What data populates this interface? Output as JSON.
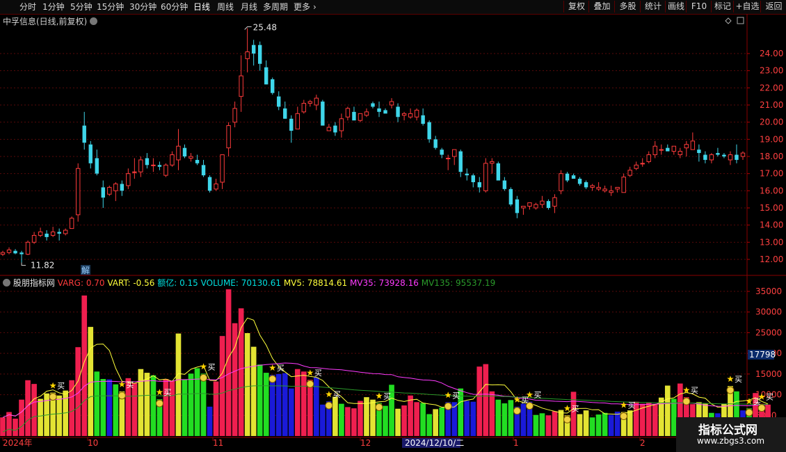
{
  "toolbar": {
    "periods": [
      "分时",
      "1分钟",
      "5分钟",
      "15分钟",
      "30分钟",
      "60分钟",
      "日线",
      "周线",
      "月线",
      "多周期",
      "更多"
    ],
    "active_period": "日线",
    "right_buttons": [
      "复权",
      "叠加",
      "多股",
      "统计",
      "画线",
      "F10",
      "标记",
      "+自选",
      "返回"
    ]
  },
  "price_panel": {
    "title": "中孚信息(日线,前复权)",
    "y_ticks": [
      "24.00",
      "23.00",
      "22.00",
      "21.00",
      "20.00",
      "19.00",
      "18.00",
      "17.00",
      "16.00",
      "15.00",
      "14.00",
      "13.00",
      "12.00"
    ],
    "max_label": "25.48",
    "min_label": "11.82",
    "marker_label": "解"
  },
  "indicator_panel": {
    "name": "股朋指标网",
    "legend": [
      {
        "text": "VARG: 0.70",
        "color": "#ff3b3b"
      },
      {
        "text": "VART: -0.56",
        "color": "#ffff3b"
      },
      {
        "text": "额亿: 0.15",
        "color": "#00e0e0"
      },
      {
        "text": "VOLUME: 70130.61",
        "color": "#00e0e0"
      },
      {
        "text": "MV5: 78814.61",
        "color": "#ffff3b"
      },
      {
        "text": "MV35: 73928.16",
        "color": "#ff3bff"
      },
      {
        "text": "MV135: 95537.19",
        "color": "#2a9a2a"
      }
    ],
    "y_ticks": [
      "35000",
      "30000",
      "25000",
      "20000",
      "15000",
      "10000",
      "5000"
    ],
    "current_value": "17798",
    "buy_label": "买"
  },
  "x_axis": {
    "labels": [
      "2024年",
      "10",
      "11",
      "12",
      "2024/12/10/二",
      "1",
      "2"
    ]
  },
  "watermark": {
    "line1": "指标公式网",
    "line2": "www.zbgs3.com"
  },
  "chart_data": [
    {
      "type": "candlestick",
      "title": "中孚信息(日线,前复权)",
      "ylim": [
        11.4,
        25.7
      ],
      "ohlc": [
        [
          12.3,
          12.5,
          12.2,
          12.4
        ],
        [
          12.4,
          12.7,
          12.3,
          12.55
        ],
        [
          12.5,
          12.6,
          12.3,
          12.35
        ],
        [
          12.4,
          12.5,
          11.82,
          12.3
        ],
        [
          12.3,
          13.1,
          12.25,
          13.0
        ],
        [
          13.0,
          13.6,
          12.9,
          13.4
        ],
        [
          13.4,
          13.85,
          13.3,
          13.6
        ],
        [
          13.5,
          13.7,
          13.1,
          13.3
        ],
        [
          13.4,
          13.9,
          13.3,
          13.6
        ],
        [
          13.6,
          13.8,
          13.1,
          13.5
        ],
        [
          13.5,
          13.8,
          13.4,
          13.7
        ],
        [
          13.8,
          14.5,
          13.8,
          14.4
        ],
        [
          14.6,
          17.6,
          14.2,
          17.3
        ],
        [
          19.8,
          20.6,
          18.4,
          18.8
        ],
        [
          18.7,
          18.9,
          17.3,
          17.6
        ],
        [
          17.9,
          18.4,
          16.9,
          17.0
        ],
        [
          16.2,
          16.6,
          15.0,
          15.6
        ],
        [
          15.8,
          16.3,
          15.7,
          16.2
        ],
        [
          16.0,
          16.5,
          15.4,
          16.4
        ],
        [
          16.4,
          16.6,
          15.7,
          16.0
        ],
        [
          16.3,
          17.3,
          16.1,
          17.0
        ],
        [
          17.1,
          17.9,
          16.7,
          17.1
        ],
        [
          17.1,
          18.0,
          16.8,
          17.8
        ],
        [
          17.9,
          18.2,
          17.3,
          17.5
        ],
        [
          17.5,
          17.9,
          17.1,
          17.5
        ],
        [
          17.5,
          17.7,
          17.2,
          17.4
        ],
        [
          16.9,
          17.6,
          16.8,
          17.5
        ],
        [
          17.5,
          18.3,
          17.4,
          18.1
        ],
        [
          17.8,
          19.6,
          17.2,
          18.6
        ],
        [
          18.5,
          18.7,
          17.9,
          18.0
        ],
        [
          17.9,
          18.2,
          17.7,
          18.0
        ],
        [
          17.8,
          18.1,
          17.5,
          17.6
        ],
        [
          17.5,
          17.8,
          16.8,
          16.9
        ],
        [
          16.8,
          16.9,
          15.9,
          16.0
        ],
        [
          16.1,
          16.7,
          16.0,
          16.4
        ],
        [
          16.5,
          18.1,
          16.1,
          18.1
        ],
        [
          18.5,
          20.0,
          18.0,
          19.8
        ],
        [
          20.0,
          21.2,
          19.7,
          20.8
        ],
        [
          21.5,
          23.9,
          20.6,
          22.7
        ],
        [
          23.7,
          25.48,
          22.9,
          24.1
        ],
        [
          24.5,
          24.8,
          23.3,
          24.0
        ],
        [
          24.5,
          24.7,
          23.0,
          23.4
        ],
        [
          23.2,
          23.6,
          22.3,
          22.2
        ],
        [
          22.5,
          22.6,
          21.6,
          21.7
        ],
        [
          21.5,
          21.8,
          20.7,
          20.9
        ],
        [
          20.8,
          21.2,
          20.3,
          20.2
        ],
        [
          20.2,
          20.4,
          18.8,
          19.5
        ],
        [
          19.6,
          20.9,
          19.6,
          20.5
        ],
        [
          20.6,
          21.3,
          20.5,
          21.1
        ],
        [
          21.1,
          21.3,
          20.9,
          21.2
        ],
        [
          21.0,
          21.6,
          20.7,
          21.4
        ],
        [
          21.2,
          21.3,
          19.8,
          19.8
        ],
        [
          19.5,
          19.9,
          19.5,
          19.7
        ],
        [
          19.8,
          20.0,
          19.2,
          19.4
        ],
        [
          19.5,
          20.5,
          19.1,
          20.2
        ],
        [
          20.3,
          20.9,
          20.1,
          20.8
        ],
        [
          20.6,
          20.9,
          20.1,
          20.1
        ],
        [
          20.1,
          20.5,
          20.0,
          20.5
        ],
        [
          20.4,
          20.8,
          20.3,
          20.6
        ],
        [
          21.1,
          21.2,
          20.8,
          20.9
        ],
        [
          20.8,
          21.2,
          20.3,
          20.6
        ],
        [
          20.7,
          20.8,
          20.5,
          20.5
        ],
        [
          21.0,
          21.4,
          20.8,
          21.2
        ],
        [
          20.9,
          21.1,
          20.0,
          20.3
        ],
        [
          20.4,
          20.6,
          20.1,
          20.5
        ],
        [
          20.3,
          20.8,
          20.2,
          20.5
        ],
        [
          20.3,
          20.8,
          20.1,
          20.7
        ],
        [
          20.4,
          20.8,
          19.8,
          19.9
        ],
        [
          20.0,
          20.1,
          18.8,
          19.0
        ],
        [
          19.0,
          19.2,
          18.4,
          18.5
        ],
        [
          18.4,
          18.5,
          17.9,
          18.1
        ],
        [
          17.9,
          18.1,
          17.2,
          17.9
        ],
        [
          18.0,
          18.3,
          17.5,
          18.4
        ],
        [
          18.3,
          18.4,
          16.8,
          17.1
        ],
        [
          17.0,
          17.3,
          16.6,
          16.9
        ],
        [
          16.9,
          17.0,
          16.2,
          16.5
        ],
        [
          16.5,
          16.8,
          15.9,
          16.2
        ],
        [
          16.0,
          17.9,
          15.9,
          17.6
        ],
        [
          17.6,
          17.9,
          17.0,
          17.7
        ],
        [
          17.6,
          17.7,
          16.6,
          16.6
        ],
        [
          16.6,
          16.8,
          16.0,
          16.1
        ],
        [
          16.1,
          16.2,
          15.1,
          15.2
        ],
        [
          15.5,
          15.7,
          14.4,
          14.7
        ],
        [
          15.0,
          15.1,
          14.6,
          15.1
        ],
        [
          15.1,
          15.3,
          14.9,
          15.3
        ],
        [
          15.0,
          15.3,
          14.9,
          15.2
        ],
        [
          15.2,
          15.7,
          15.0,
          15.4
        ],
        [
          15.4,
          15.5,
          14.9,
          15.0
        ],
        [
          15.1,
          15.8,
          14.7,
          15.6
        ],
        [
          16.0,
          17.2,
          15.8,
          17.0
        ],
        [
          17.0,
          17.1,
          16.5,
          16.6
        ],
        [
          16.9,
          17.0,
          16.7,
          16.7
        ],
        [
          16.7,
          16.8,
          16.3,
          16.4
        ],
        [
          16.5,
          16.6,
          16.1,
          16.2
        ],
        [
          16.2,
          16.4,
          16.0,
          16.3
        ],
        [
          16.1,
          16.5,
          16.0,
          16.2
        ],
        [
          16.0,
          16.3,
          15.9,
          16.1
        ],
        [
          15.9,
          16.3,
          15.7,
          16.0
        ],
        [
          16.1,
          16.2,
          15.9,
          16.2
        ],
        [
          15.9,
          17.0,
          15.9,
          16.8
        ],
        [
          16.9,
          17.4,
          16.8,
          17.2
        ],
        [
          17.3,
          17.7,
          17.2,
          17.5
        ],
        [
          17.6,
          17.9,
          17.4,
          17.6
        ],
        [
          17.7,
          18.3,
          17.6,
          18.1
        ],
        [
          18.1,
          18.9,
          17.9,
          18.6
        ],
        [
          18.4,
          18.7,
          18.1,
          18.4
        ],
        [
          18.5,
          18.7,
          18.3,
          18.3
        ],
        [
          18.3,
          18.6,
          18.1,
          18.6
        ],
        [
          18.1,
          18.5,
          17.9,
          18.3
        ],
        [
          18.5,
          18.9,
          18.0,
          18.7
        ],
        [
          18.4,
          19.4,
          18.4,
          18.9
        ],
        [
          18.4,
          18.7,
          17.7,
          18.2
        ],
        [
          18.1,
          18.3,
          17.6,
          17.8
        ],
        [
          17.8,
          18.2,
          17.6,
          18.1
        ],
        [
          18.2,
          18.5,
          18.0,
          18.1
        ],
        [
          18.1,
          18.2,
          17.9,
          18.0
        ],
        [
          17.8,
          18.3,
          17.5,
          18.1
        ],
        [
          18.1,
          18.7,
          17.6,
          17.8
        ],
        [
          18.0,
          18.3,
          17.8,
          18.2
        ]
      ]
    },
    {
      "type": "bar",
      "title": "股朋指标网",
      "ylim": [
        0,
        37000
      ],
      "values": [
        4500,
        5800,
        4200,
        8800,
        13500,
        12600,
        9000,
        10300,
        10500,
        9800,
        11000,
        13500,
        21500,
        34000,
        26400,
        15600,
        13800,
        13700,
        12500,
        10800,
        14000,
        12800,
        16200,
        15300,
        14700,
        8900,
        13800,
        13400,
        24800,
        13700,
        15100,
        16400,
        15100,
        7100,
        13200,
        24200,
        35500,
        27300,
        30900,
        24900,
        21600,
        17300,
        15300,
        14800,
        15000,
        15200,
        11500,
        16200,
        15600,
        13600,
        14200,
        7600,
        8400,
        9500,
        7800,
        7000,
        6700,
        8500,
        9400,
        8800,
        8000,
        7300,
        12400,
        6600,
        7400,
        9800,
        8200,
        8000,
        5300,
        6500,
        6900,
        8200,
        8200,
        11500,
        8500,
        8300,
        16800,
        17400,
        10800,
        8800,
        7900,
        8700,
        7100,
        7800,
        8300,
        5100,
        5500,
        5000,
        6000,
        6300,
        5000,
        10700,
        5300,
        6200,
        4500,
        5200,
        5600,
        5100,
        5900,
        5800,
        6200,
        8300,
        7800,
        8000,
        7700,
        9300,
        12200,
        9000,
        12700,
        9400,
        7700,
        8200,
        7800,
        5600,
        5500,
        7800,
        12100,
        10800,
        6200,
        6700,
        10400,
        7800,
        7600
      ],
      "colors": [
        "#ef1f4f",
        "#ef1f4f",
        "#ef1f4f",
        "#ef1f4f",
        "#ef1f4f",
        "#ef1f4f",
        "#e3e333",
        "#e3e333",
        "#e3e333",
        "#e3e333",
        "#e3e333",
        "#ef1f4f",
        "#ef1f4f",
        "#ef1f4f",
        "#e3e333",
        "#22dd22",
        "#22dd22",
        "#1a1ad8",
        "#22dd22",
        "#e3e333",
        "#ef1f4f",
        "#ef1f4f",
        "#e3e333",
        "#e3e333",
        "#22dd22",
        "#22dd22",
        "#ef1f4f",
        "#ef1f4f",
        "#e3e333",
        "#22dd22",
        "#22dd22",
        "#22dd22",
        "#22dd22",
        "#1a1ad8",
        "#ef1f4f",
        "#ef1f4f",
        "#ef1f4f",
        "#ef1f4f",
        "#ef1f4f",
        "#e3e333",
        "#e3e333",
        "#22dd22",
        "#22dd22",
        "#1a1ad8",
        "#1a1ad8",
        "#1a1ad8",
        "#1a1ad8",
        "#ef1f4f",
        "#ef1f4f",
        "#ef1f4f",
        "#1a1ad8",
        "#1a1ad8",
        "#1a1ad8",
        "#e3e333",
        "#22dd22",
        "#ef1f4f",
        "#ef1f4f",
        "#ef1f4f",
        "#e3e333",
        "#e3e333",
        "#22dd22",
        "#22dd22",
        "#22dd22",
        "#e3e333",
        "#ef1f4f",
        "#ef1f4f",
        "#ef1f4f",
        "#22dd22",
        "#22dd22",
        "#e3e333",
        "#22dd22",
        "#1a1ad8",
        "#1a1ad8",
        "#22dd22",
        "#1a1ad8",
        "#1a1ad8",
        "#ef1f4f",
        "#ef1f4f",
        "#ef1f4f",
        "#22dd22",
        "#22dd22",
        "#22dd22",
        "#1a1ad8",
        "#1a1ad8",
        "#1a1ad8",
        "#22dd22",
        "#22dd22",
        "#ef1f4f",
        "#ef1f4f",
        "#e3e333",
        "#e3e333",
        "#ef1f4f",
        "#e3e333",
        "#e3e333",
        "#22dd22",
        "#22dd22",
        "#22dd22",
        "#1a1ad8",
        "#1a1ad8",
        "#e3e333",
        "#e3e333",
        "#ef1f4f",
        "#ef1f4f",
        "#ef1f4f",
        "#ef1f4f",
        "#e3e333",
        "#e3e333",
        "#22dd22",
        "#ef1f4f",
        "#ef1f4f",
        "#ef1f4f",
        "#e3e333",
        "#e3e333",
        "#22dd22",
        "#1a1ad8",
        "#e3e333",
        "#e3e333",
        "#22dd22",
        "#1a1ad8",
        "#22dd22",
        "#ef1f4f",
        "#ef1f4f",
        "#ef1f4f"
      ],
      "buy_signal_bars": [
        8,
        19,
        25,
        32,
        43,
        49,
        52,
        60,
        71,
        82,
        84,
        90,
        99,
        109,
        116,
        119,
        121
      ]
    }
  ]
}
